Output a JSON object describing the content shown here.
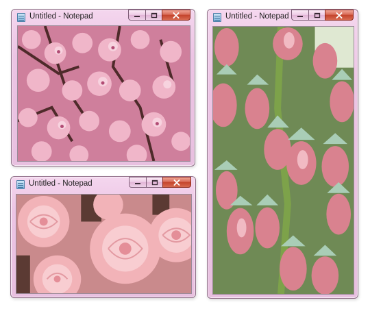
{
  "windows": [
    {
      "title": "Untitled - Notepad",
      "icon": "notepad-icon",
      "content": "pink cherry blossoms"
    },
    {
      "title": "Untitled - Notepad",
      "icon": "notepad-icon",
      "content": "pink rose-like flowers"
    },
    {
      "title": "Untitled - Notepad",
      "icon": "notepad-icon",
      "content": "hanging bell-shaped flowers"
    }
  ],
  "controls": {
    "minimize": "minimize-icon",
    "maximize": "maximize-icon",
    "close": "close-icon"
  },
  "colors": {
    "frame": "#ecc4e4",
    "close": "#c4432b"
  }
}
